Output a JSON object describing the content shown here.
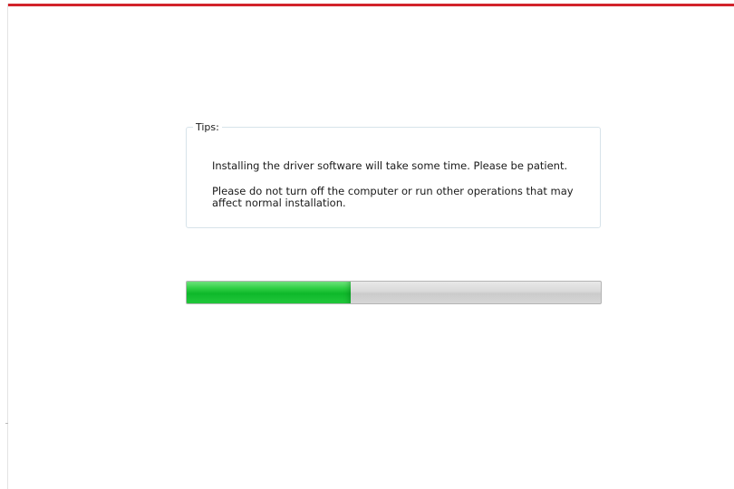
{
  "tips": {
    "legend": "Tips:",
    "line1": "Installing the driver software will take some time. Please be patient.",
    "line2": "Please do not turn off the computer or run other operations that may affect normal installation."
  },
  "progress": {
    "fraction": 0.396
  },
  "colors": {
    "accent": "#d2232a",
    "progress_fill": "#0eb82a",
    "progress_track": "#d6d6d6"
  }
}
